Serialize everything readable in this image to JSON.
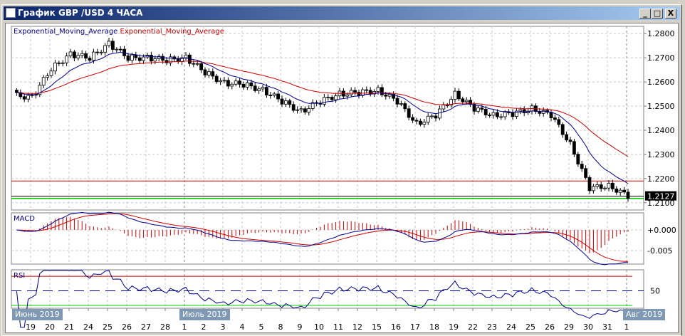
{
  "window": {
    "title": "График GBP /USD  4 ЧАСА",
    "minimize": "_",
    "maximize": "□",
    "close": "X"
  },
  "legend": {
    "ema_fast": "Exponential_Moving_Average",
    "ema_slow": "Exponential_Moving_Average"
  },
  "colors": {
    "ema_fast": "#00008b",
    "ema_slow": "#cc0000",
    "support": "#cc0000",
    "green": "#00cc00",
    "title_start": "#0a246a"
  },
  "chart_data": {
    "type": "candlestick",
    "symbol": "GBP/USD",
    "timeframe": "4H",
    "x_labels": [
      "19",
      "20",
      "21",
      "24",
      "25",
      "26",
      "27",
      "28",
      "1",
      "2",
      "3",
      "4",
      "5",
      "8",
      "9",
      "10",
      "11",
      "12",
      "15",
      "16",
      "17",
      "18",
      "19",
      "22",
      "23",
      "24",
      "25",
      "26",
      "29",
      "30",
      "31",
      "1"
    ],
    "month_labels": [
      "Июнь 2019",
      "Июль 2019",
      "Авг 2019"
    ],
    "daily_close": [
      1.2536,
      1.2655,
      1.2714,
      1.27,
      1.2758,
      1.27,
      1.27,
      1.269,
      1.27,
      1.264,
      1.2595,
      1.259,
      1.2566,
      1.252,
      1.2477,
      1.252,
      1.255,
      1.2556,
      1.2565,
      1.252,
      1.2426,
      1.2462,
      1.255,
      1.249,
      1.2462,
      1.2468,
      1.249,
      1.2462,
      1.2343,
      1.216,
      1.2171,
      1.2127
    ],
    "y_ticks": [
      "1.2800",
      "1.2700",
      "1.2600",
      "1.2500",
      "1.2400",
      "1.2300",
      "1.2200",
      "1.2100"
    ],
    "ylim": [
      1.207,
      1.283
    ],
    "current_price": "1.2127",
    "hlines": {
      "red": 1.219,
      "green": 1.2118
    },
    "macd": {
      "label": "MACD",
      "ticks": [
        "+0.000",
        "-0.005"
      ]
    },
    "rsi": {
      "label": "RSI",
      "tick": "50",
      "levels": [
        70,
        50,
        30
      ]
    }
  }
}
